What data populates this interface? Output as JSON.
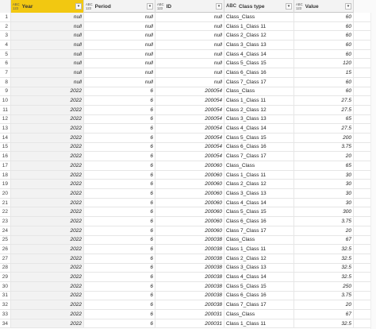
{
  "columns": {
    "year": {
      "type": "ABC\n123",
      "name": "Year"
    },
    "period": {
      "type": "ABC\n123",
      "name": "Period"
    },
    "id": {
      "type": "ABC\n123",
      "name": "ID"
    },
    "class_type": {
      "type": "ABC",
      "name": "Class type"
    },
    "value": {
      "type": "ABC\n123",
      "name": "Value"
    }
  },
  "rows": [
    [
      "1",
      "null",
      "null",
      "null",
      "Class_Class",
      "60"
    ],
    [
      "2",
      "null",
      "null",
      "null",
      "Class 1_Class 11",
      "60"
    ],
    [
      "3",
      "null",
      "null",
      "null",
      "Class 2_Class 12",
      "60"
    ],
    [
      "4",
      "null",
      "null",
      "null",
      "Class 3_Class 13",
      "60"
    ],
    [
      "5",
      "null",
      "null",
      "null",
      "Class 4_Class 14",
      "60"
    ],
    [
      "6",
      "null",
      "null",
      "null",
      "Class 5_Class 15",
      "120"
    ],
    [
      "7",
      "null",
      "null",
      "null",
      "Class 6_Class 16",
      "15"
    ],
    [
      "8",
      "null",
      "null",
      "null",
      "Class 7_Class 17",
      "60"
    ],
    [
      "9",
      "2022",
      "6",
      "200054",
      "Class_Class",
      "60"
    ],
    [
      "10",
      "2022",
      "6",
      "200054",
      "Class 1_Class 11",
      "27.5"
    ],
    [
      "11",
      "2022",
      "6",
      "200054",
      "Class 2_Class 12",
      "27.5"
    ],
    [
      "12",
      "2022",
      "6",
      "200054",
      "Class 3_Class 13",
      "65"
    ],
    [
      "13",
      "2022",
      "6",
      "200054",
      "Class 4_Class 14",
      "27.5"
    ],
    [
      "14",
      "2022",
      "6",
      "200054",
      "Class 5_Class 15",
      "200"
    ],
    [
      "15",
      "2022",
      "6",
      "200054",
      "Class 6_Class 16",
      "3.75"
    ],
    [
      "16",
      "2022",
      "6",
      "200054",
      "Class 7_Class 17",
      "20"
    ],
    [
      "17",
      "2022",
      "6",
      "200060",
      "Class_Class",
      "65"
    ],
    [
      "18",
      "2022",
      "6",
      "200060",
      "Class 1_Class 11",
      "30"
    ],
    [
      "19",
      "2022",
      "6",
      "200060",
      "Class 2_Class 12",
      "30"
    ],
    [
      "20",
      "2022",
      "6",
      "200060",
      "Class 3_Class 13",
      "30"
    ],
    [
      "21",
      "2022",
      "6",
      "200060",
      "Class 4_Class 14",
      "30"
    ],
    [
      "22",
      "2022",
      "6",
      "200060",
      "Class 5_Class 15",
      "300"
    ],
    [
      "23",
      "2022",
      "6",
      "200060",
      "Class 6_Class 16",
      "3.75"
    ],
    [
      "24",
      "2022",
      "6",
      "200060",
      "Class 7_Class 17",
      "20"
    ],
    [
      "25",
      "2022",
      "6",
      "200038",
      "Class_Class",
      "67"
    ],
    [
      "26",
      "2022",
      "6",
      "200038",
      "Class 1_Class 11",
      "32.5"
    ],
    [
      "27",
      "2022",
      "6",
      "200038",
      "Class 2_Class 12",
      "32.5"
    ],
    [
      "28",
      "2022",
      "6",
      "200038",
      "Class 3_Class 13",
      "32.5"
    ],
    [
      "29",
      "2022",
      "6",
      "200038",
      "Class 4_Class 14",
      "32.5"
    ],
    [
      "30",
      "2022",
      "6",
      "200038",
      "Class 5_Class 15",
      "250"
    ],
    [
      "31",
      "2022",
      "6",
      "200038",
      "Class 6_Class 16",
      "3.75"
    ],
    [
      "32",
      "2022",
      "6",
      "200038",
      "Class 7_Class 17",
      "20"
    ],
    [
      "33",
      "2022",
      "6",
      "200031",
      "Class_Class",
      "67"
    ],
    [
      "34",
      "2022",
      "6",
      "200031",
      "Class 1_Class 11",
      "32.5"
    ]
  ],
  "colors": {
    "selected_header": "#f2c811"
  }
}
